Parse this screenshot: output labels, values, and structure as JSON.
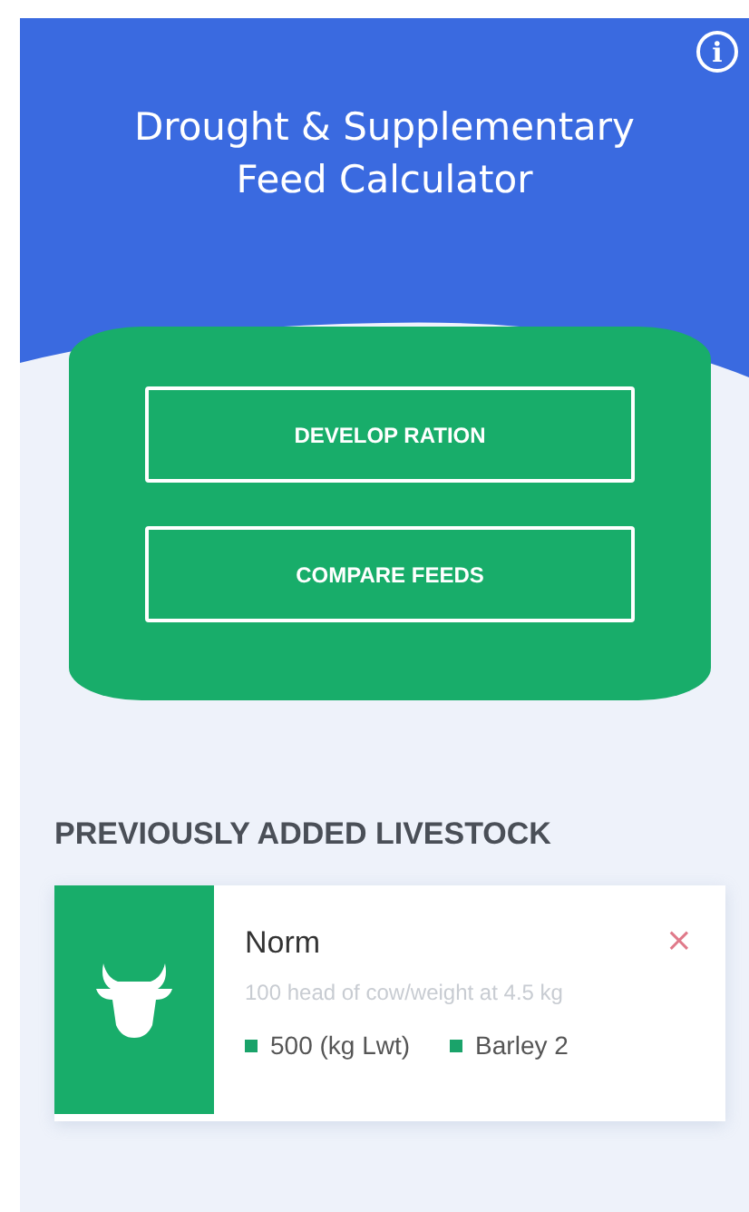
{
  "header": {
    "title": "Drought & Supplementary Feed Calculator",
    "info_icon": "i"
  },
  "actions": [
    {
      "label": "DEVELOP RATION"
    },
    {
      "label": "COMPARE FEEDS"
    }
  ],
  "section_title": "PREVIOUSLY ADDED LIVESTOCK",
  "livestock": [
    {
      "name": "Norm",
      "close": "×",
      "description": "100 head of cow/weight at 4.5 kg",
      "tags": [
        {
          "text": "500 (kg Lwt)",
          "color": "#1aa36a"
        },
        {
          "text": "Barley 2",
          "color": "#1aa36a"
        }
      ]
    }
  ]
}
